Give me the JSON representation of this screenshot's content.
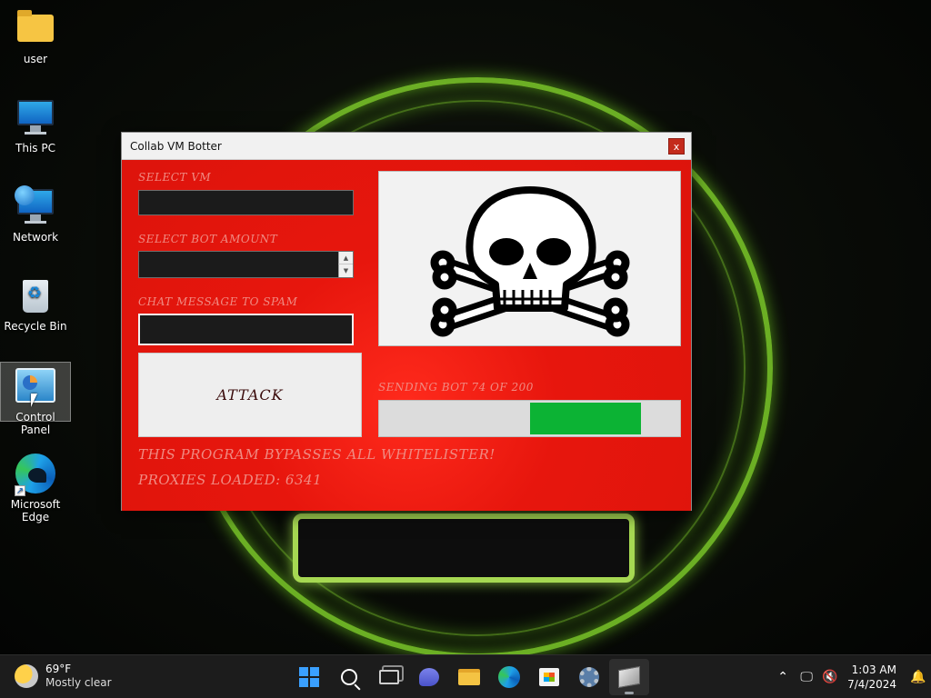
{
  "desktop": {
    "icons": [
      {
        "label": "user",
        "icon": "folder-icon"
      },
      {
        "label": "This PC",
        "icon": "computer-icon"
      },
      {
        "label": "Network",
        "icon": "network-icon"
      },
      {
        "label": "Recycle Bin",
        "icon": "recycle-bin-icon"
      },
      {
        "label": "Control Panel",
        "icon": "control-panel-icon"
      },
      {
        "label": "Microsoft Edge",
        "icon": "edge-icon"
      }
    ]
  },
  "window": {
    "title": "Collab VM Botter",
    "close_label": "x",
    "select_vm_label": "SELECT VM",
    "bot_amount_label": "SELECT BOT AMOUNT",
    "chat_message_label": "CHAT MESSAGE TO SPAM",
    "select_vm_value": "",
    "bot_amount_value": "",
    "chat_message_value": "",
    "spin_up": "▲",
    "spin_down": "▼",
    "attack_label": "ATTACK",
    "image_icon": "skull-crossbones-icon",
    "progress_text": "SENDING BOT 74 OF 200",
    "progress_fraction": 0.37,
    "bypass_text": "THIS PROGRAM BYPASSES ALL WHITELISTER!",
    "proxies_text": "PROXIES LOADED: 6341",
    "colors": {
      "background": "#e11b12",
      "progress": "#0cb334"
    }
  },
  "taskbar": {
    "temperature": "69°F",
    "condition": "Mostly clear",
    "time": "1:03 AM",
    "date": "7/4/2024",
    "tray_chevron": "^",
    "pinned": [
      "start-icon",
      "search-icon",
      "task-view-icon",
      "chat-icon",
      "file-explorer-icon",
      "edge-icon",
      "store-icon",
      "settings-icon",
      "app-icon"
    ]
  }
}
